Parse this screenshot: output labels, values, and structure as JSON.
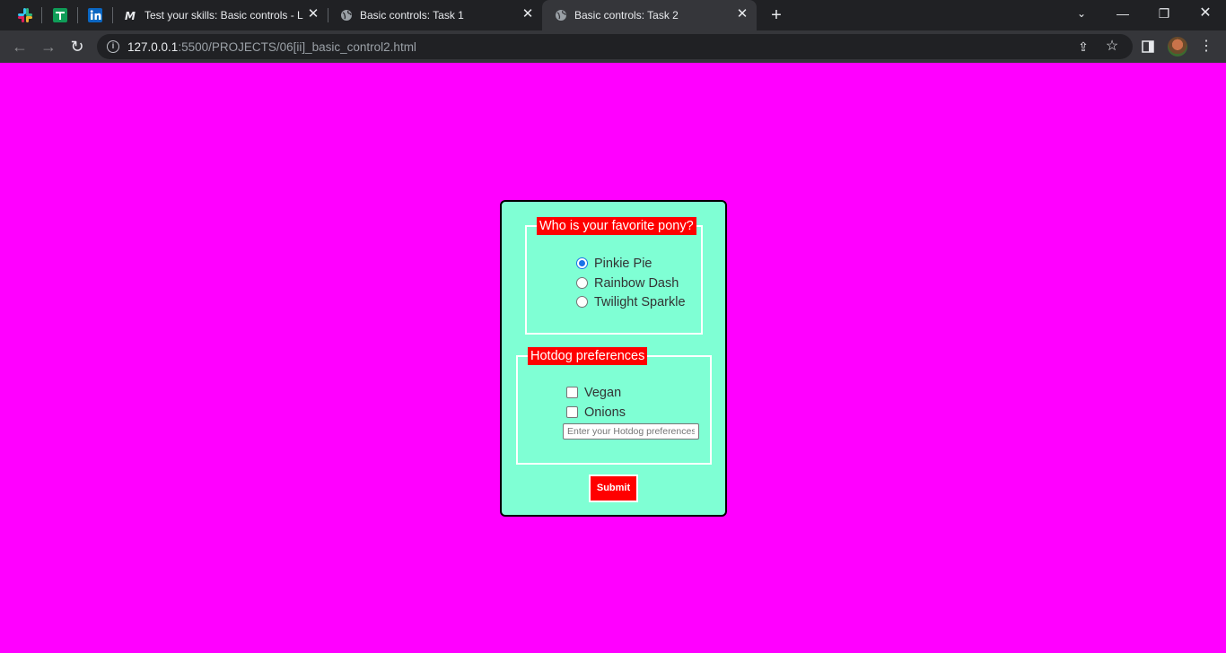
{
  "browser": {
    "pinned_tabs": [
      {
        "icon": "slack-icon",
        "color": "#e01e5a"
      },
      {
        "icon": "google-sheets-icon",
        "color": "#0f9d58"
      },
      {
        "icon": "linkedin-icon",
        "color": "#0a66c2"
      }
    ],
    "tabs": [
      {
        "title": "Test your skills: Basic controls - Le",
        "icon": "mdn-icon",
        "active": false
      },
      {
        "title": "Basic controls: Task 1",
        "icon": "globe-icon",
        "active": false
      },
      {
        "title": "Basic controls: Task 2",
        "icon": "globe-icon",
        "active": true
      }
    ],
    "address": {
      "host": "127.0.0.1",
      "path": ":5500/PROJECTS/06[ii]_basic_control2.html"
    }
  },
  "page": {
    "background": "#ff00ff",
    "card_background": "#7fffd4",
    "accent": "#ff0000",
    "pony": {
      "legend": "Who is your favorite pony?",
      "options": [
        {
          "label": "Pinkie Pie",
          "checked": true
        },
        {
          "label": "Rainbow Dash",
          "checked": false
        },
        {
          "label": "Twilight Sparkle",
          "checked": false
        }
      ]
    },
    "hotdog": {
      "legend": "Hotdog preferences",
      "options": [
        {
          "label": "Vegan",
          "checked": false
        },
        {
          "label": "Onions",
          "checked": false
        }
      ],
      "input_value": "",
      "input_placeholder": "Enter your Hotdog preferences"
    },
    "submit_label": "Submit"
  }
}
